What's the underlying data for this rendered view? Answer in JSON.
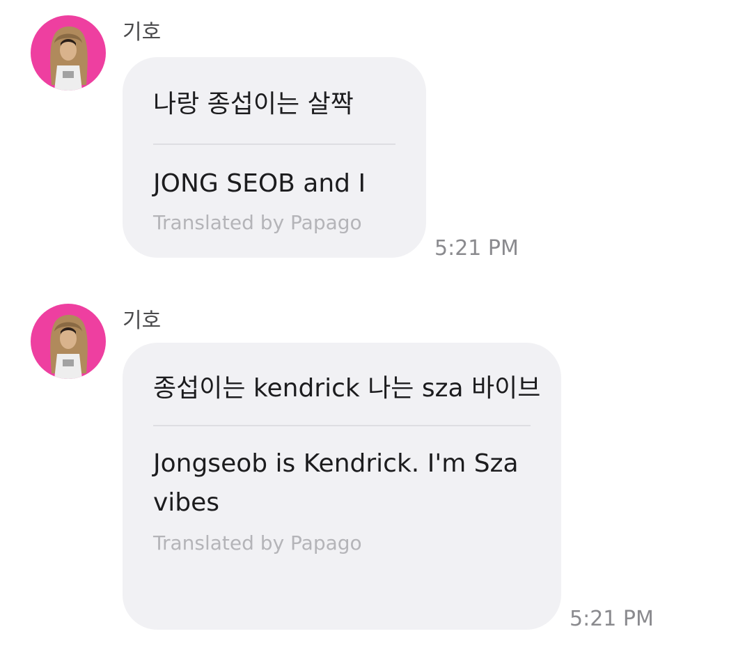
{
  "messages": [
    {
      "sender": "기호",
      "original": "나랑 종섭이는 살짝",
      "translated": "JONG SEOB and I",
      "translated_by": "Translated by Papago",
      "time": "5:21 PM"
    },
    {
      "sender": "기호",
      "original": "종섭이는 kendrick 나는 sza 바이브",
      "translated": "Jongseob is Kendrick. I'm Sza vibes",
      "translated_by": "Translated by Papago",
      "time": "5:21 PM"
    }
  ],
  "colors": {
    "avatar_bg": "#ee3fa0",
    "bubble_bg": "#f1f1f4",
    "divider": "#dedee2",
    "muted_text": "#b4b4b8",
    "timestamp": "#8a8a8e"
  },
  "icons": {
    "avatar": "profile-photo"
  }
}
